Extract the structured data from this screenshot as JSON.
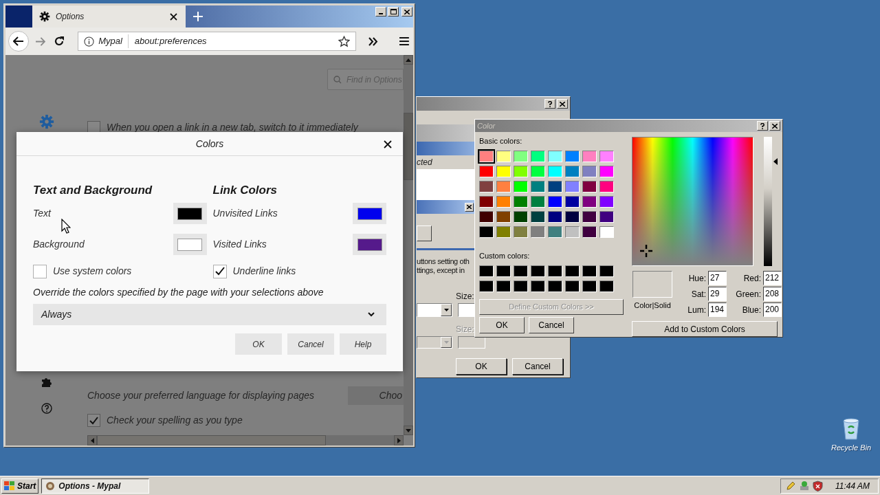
{
  "browser": {
    "tabs": [
      {
        "label": "Options",
        "selected": true
      }
    ],
    "address": {
      "identity": "Mypal",
      "url": "about:preferences"
    },
    "search": {
      "placeholder": "Find in Options"
    },
    "options": [
      {
        "kind": "checkbox",
        "label": "When you open a link in a new tab, switch to it immediately",
        "checked": false
      },
      {
        "kind": "button-row",
        "label": "Choose your preferred language for displaying pages",
        "button": "Choo"
      },
      {
        "kind": "checkbox",
        "label": "Check your spelling as you type",
        "checked": true
      }
    ]
  },
  "back_dialog": {
    "list_header": "cted",
    "description": [
      "uttons setting oth",
      "ttings, except in"
    ],
    "size_labels": [
      {
        "label": "Size:",
        "disabled": false
      },
      {
        "label": "Size:",
        "disabled": true
      }
    ],
    "buttons": [
      "OK",
      "Cancel"
    ]
  },
  "colors_dialog": {
    "title": "Colors",
    "groups": [
      {
        "heading": "Text and Background",
        "colors": [
          {
            "label": "Text",
            "color": "#000000"
          },
          {
            "label": "Background",
            "color": "#ffffff"
          }
        ],
        "checkbox": {
          "label": "Use system colors",
          "checked": false
        }
      },
      {
        "heading": "Link Colors",
        "colors": [
          {
            "label": "Unvisited Links",
            "color": "#0000ee"
          },
          {
            "label": "Visited Links",
            "color": "#551a8b"
          }
        ],
        "checkbox": {
          "label": "Underline links",
          "checked": true
        }
      }
    ],
    "override": {
      "label": "Override the colors specified by the page with your selections above",
      "value": "Always"
    },
    "buttons": [
      "OK",
      "Cancel",
      "Help"
    ]
  },
  "color_dialog": {
    "title": "Color",
    "basic_label": "Basic colors:",
    "basic_colors": [
      {
        "color": "#ff8080",
        "selected": true
      },
      {
        "color": "#ffff80",
        "selected": false
      },
      {
        "color": "#80ff80",
        "selected": false
      },
      {
        "color": "#00ff80",
        "selected": false
      },
      {
        "color": "#80ffff",
        "selected": false
      },
      {
        "color": "#0080ff",
        "selected": false
      },
      {
        "color": "#ff80c0",
        "selected": false
      },
      {
        "color": "#ff80ff",
        "selected": false
      },
      {
        "color": "#ff0000",
        "selected": false
      },
      {
        "color": "#ffff00",
        "selected": false
      },
      {
        "color": "#80ff00",
        "selected": false
      },
      {
        "color": "#00ff40",
        "selected": false
      },
      {
        "color": "#00ffff",
        "selected": false
      },
      {
        "color": "#0080c0",
        "selected": false
      },
      {
        "color": "#8080c0",
        "selected": false
      },
      {
        "color": "#ff00ff",
        "selected": false
      },
      {
        "color": "#804040",
        "selected": false
      },
      {
        "color": "#ff8040",
        "selected": false
      },
      {
        "color": "#00ff00",
        "selected": false
      },
      {
        "color": "#008080",
        "selected": false
      },
      {
        "color": "#004080",
        "selected": false
      },
      {
        "color": "#8080ff",
        "selected": false
      },
      {
        "color": "#800040",
        "selected": false
      },
      {
        "color": "#ff0080",
        "selected": false
      },
      {
        "color": "#800000",
        "selected": false
      },
      {
        "color": "#ff8000",
        "selected": false
      },
      {
        "color": "#008000",
        "selected": false
      },
      {
        "color": "#008040",
        "selected": false
      },
      {
        "color": "#0000ff",
        "selected": false
      },
      {
        "color": "#0000a0",
        "selected": false
      },
      {
        "color": "#800080",
        "selected": false
      },
      {
        "color": "#8000ff",
        "selected": false
      },
      {
        "color": "#400000",
        "selected": false
      },
      {
        "color": "#804000",
        "selected": false
      },
      {
        "color": "#004000",
        "selected": false
      },
      {
        "color": "#004040",
        "selected": false
      },
      {
        "color": "#000080",
        "selected": false
      },
      {
        "color": "#000040",
        "selected": false
      },
      {
        "color": "#400040",
        "selected": false
      },
      {
        "color": "#400080",
        "selected": false
      },
      {
        "color": "#000000",
        "selected": false
      },
      {
        "color": "#808000",
        "selected": false
      },
      {
        "color": "#808040",
        "selected": false
      },
      {
        "color": "#808080",
        "selected": false
      },
      {
        "color": "#408080",
        "selected": false
      },
      {
        "color": "#c0c0c0",
        "selected": false
      },
      {
        "color": "#400040",
        "selected": false
      },
      {
        "color": "#ffffff",
        "selected": false
      }
    ],
    "custom_label": "Custom colors:",
    "custom_colors": [
      {
        "color": "#000000"
      },
      {
        "color": "#000000"
      },
      {
        "color": "#000000"
      },
      {
        "color": "#000000"
      },
      {
        "color": "#000000"
      },
      {
        "color": "#000000"
      },
      {
        "color": "#000000"
      },
      {
        "color": "#000000"
      },
      {
        "color": "#000000"
      },
      {
        "color": "#000000"
      },
      {
        "color": "#000000"
      },
      {
        "color": "#000000"
      },
      {
        "color": "#000000"
      },
      {
        "color": "#000000"
      },
      {
        "color": "#000000"
      },
      {
        "color": "#000000"
      }
    ],
    "define_button": {
      "label": "Define Custom Colors >>",
      "disabled": true
    },
    "buttons": [
      "OK",
      "Cancel"
    ],
    "luminance": {
      "level": 0.81
    },
    "preview_label": "Color|Solid",
    "hsl_fields": [
      {
        "label": "Hue:",
        "value": "27"
      },
      {
        "label": "Sat:",
        "value": "29"
      },
      {
        "label": "Lum:",
        "value": "194"
      }
    ],
    "rgb_fields": [
      {
        "label": "Red:",
        "value": "212"
      },
      {
        "label": "Green:",
        "value": "208"
      },
      {
        "label": "Blue:",
        "value": "200"
      }
    ],
    "add_button": "Add to Custom Colors"
  },
  "desktop": {
    "icons": [
      {
        "label": "Recycle Bin"
      }
    ]
  },
  "taskbar": {
    "start": "Start",
    "tasks": [
      {
        "label": "Options - Mypal",
        "selected": true
      }
    ],
    "clock": "11:44 AM"
  }
}
